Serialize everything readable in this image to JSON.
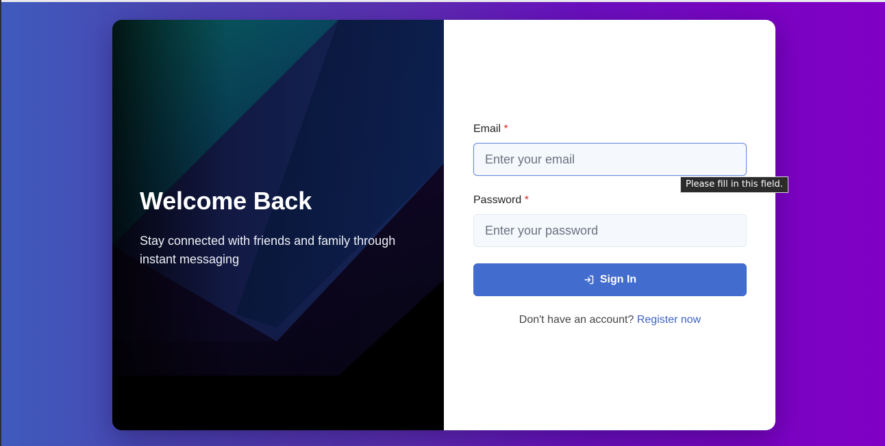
{
  "hero": {
    "title": "Welcome Back",
    "subtitle": "Stay connected with friends and family through instant messaging"
  },
  "form": {
    "email_label": "Email",
    "email_placeholder": "Enter your email",
    "password_label": "Password",
    "password_placeholder": "Enter your password",
    "required_marker": "*",
    "submit_label": "Sign In",
    "submit_icon": "login-icon",
    "register_prompt": "Don't have an account?",
    "register_link": "Register now"
  },
  "tooltip": {
    "text": "Please fill in this field."
  },
  "colors": {
    "accent": "#436ccf",
    "link": "#3d63c9",
    "required": "#e02424",
    "background_start": "#3f5bbd",
    "background_end": "#7f00c4"
  }
}
